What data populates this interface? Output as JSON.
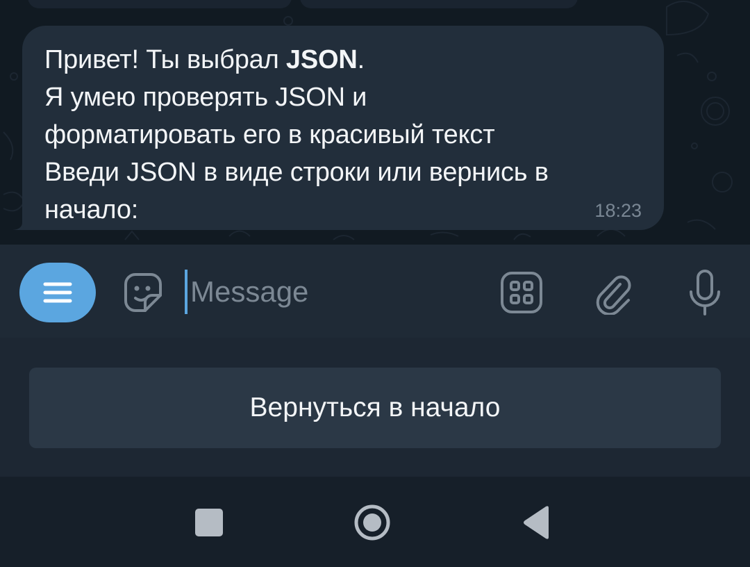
{
  "message": {
    "line1_prefix": "Привет! Ты выбрал ",
    "line1_bold": "JSON",
    "line1_suffix": ".",
    "line2": "Я умею проверять JSON и",
    "line3": "форматировать его в красивый текст",
    "line4": "Введи JSON в виде строки или вернись в",
    "line5": "начало:",
    "time": "18:23"
  },
  "composer": {
    "placeholder": "Message",
    "icons": [
      "menu-icon",
      "sticker-icon",
      "keyboard-grid-icon",
      "attach-icon",
      "microphone-icon"
    ]
  },
  "keyboard": {
    "button_label": "Вернуться в начало"
  },
  "navigation": {
    "icons": [
      "recent-apps-icon",
      "home-icon",
      "back-icon"
    ]
  },
  "colors": {
    "chat_background": "#111a22",
    "bubble": "#222e3b",
    "accent": "#5ba6e0",
    "text": "#f3f5f7",
    "muted": "#7c8894"
  }
}
